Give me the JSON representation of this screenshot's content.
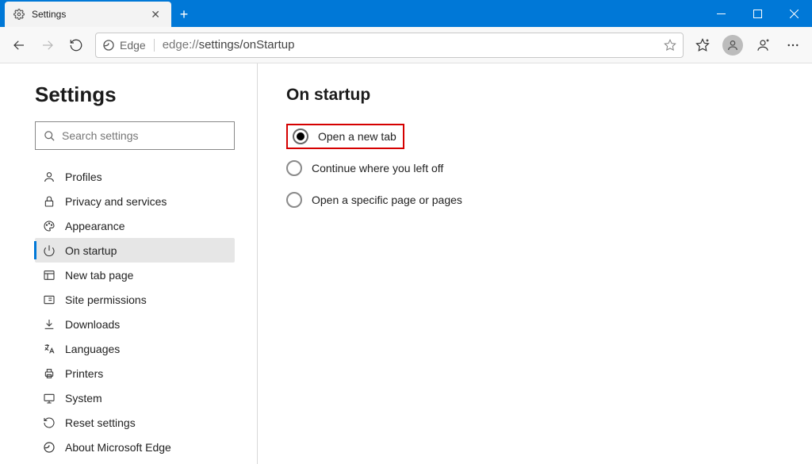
{
  "tab": {
    "title": "Settings"
  },
  "addressbar": {
    "chip": "Edge",
    "url_prefix": "edge://",
    "url_rest": "settings/onStartup"
  },
  "sidebar": {
    "title": "Settings",
    "search_placeholder": "Search settings",
    "items": [
      {
        "label": "Profiles"
      },
      {
        "label": "Privacy and services"
      },
      {
        "label": "Appearance"
      },
      {
        "label": "On startup"
      },
      {
        "label": "New tab page"
      },
      {
        "label": "Site permissions"
      },
      {
        "label": "Downloads"
      },
      {
        "label": "Languages"
      },
      {
        "label": "Printers"
      },
      {
        "label": "System"
      },
      {
        "label": "Reset settings"
      },
      {
        "label": "About Microsoft Edge"
      }
    ]
  },
  "main": {
    "heading": "On startup",
    "options": [
      {
        "label": "Open a new tab"
      },
      {
        "label": "Continue where you left off"
      },
      {
        "label": "Open a specific page or pages"
      }
    ]
  }
}
